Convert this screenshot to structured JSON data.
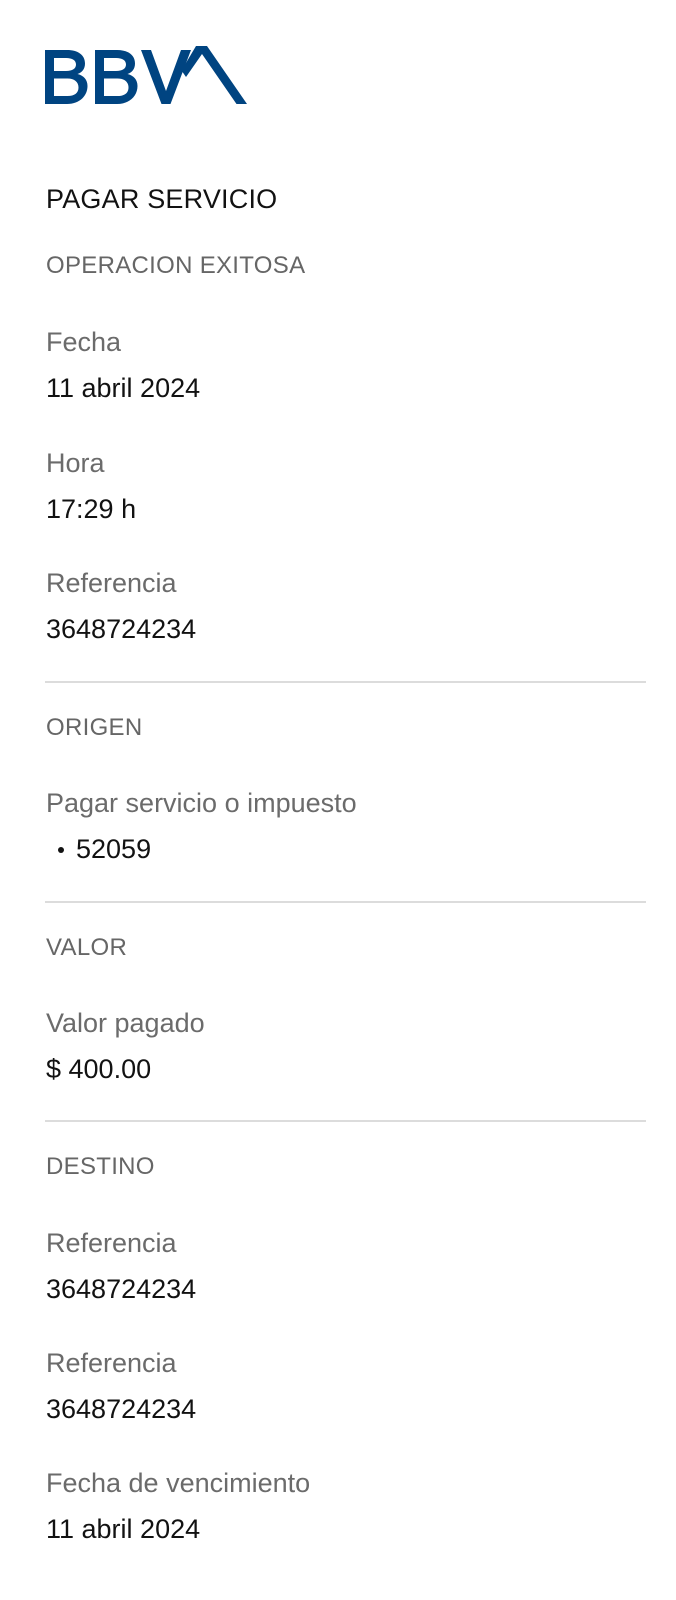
{
  "brand": {
    "logo_text": "BBVA",
    "color": "#004481"
  },
  "header": {
    "title": "PAGAR SERVICIO"
  },
  "status": {
    "title": "OPERACION EXITOSA",
    "fields": [
      {
        "label": "Fecha",
        "value": "11 abril 2024"
      },
      {
        "label": "Hora",
        "value": "17:29 h"
      },
      {
        "label": "Referencia",
        "value": "3648724234"
      }
    ]
  },
  "origin": {
    "title": "ORIGEN",
    "label": "Pagar servicio o impuesto",
    "account": "52059"
  },
  "amount": {
    "title": "VALOR",
    "label": "Valor pagado",
    "value": "$ 400.00"
  },
  "destination": {
    "title": "DESTINO",
    "fields": [
      {
        "label": "Referencia",
        "value": "3648724234"
      },
      {
        "label": "Referencia",
        "value": "3648724234"
      },
      {
        "label": "Fecha de vencimiento",
        "value": "11 abril 2024"
      }
    ]
  }
}
